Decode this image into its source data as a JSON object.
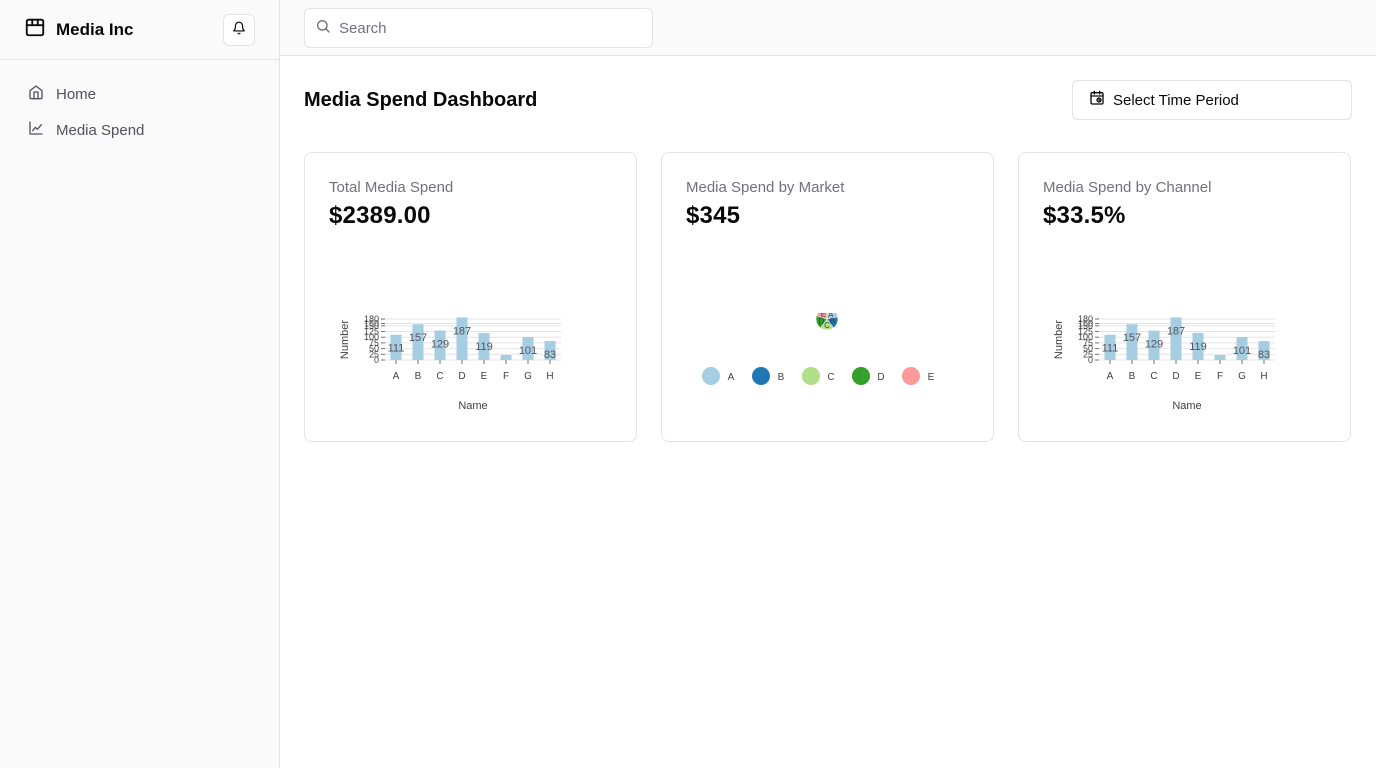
{
  "sidebar": {
    "brand": "Media Inc",
    "nav": [
      {
        "label": "Home",
        "icon": "home-icon"
      },
      {
        "label": "Media Spend",
        "icon": "line-chart-icon"
      }
    ]
  },
  "search": {
    "placeholder": "Search",
    "value": ""
  },
  "header": {
    "title": "Media Spend Dashboard",
    "period_button": "Select Time Period"
  },
  "cards": [
    {
      "label": "Total Media Spend",
      "value": "$2389.00"
    },
    {
      "label": "Media Spend by Market",
      "value": "$345"
    },
    {
      "label": "Media Spend by Channel",
      "value": "$33.5%"
    }
  ],
  "colors": {
    "bar": "#a6cee3",
    "pie": [
      "#a6cee3",
      "#1f78b4",
      "#b2df8a",
      "#33a02c",
      "#fb9a99"
    ]
  },
  "chart_data": [
    {
      "type": "bar",
      "categories": [
        "A",
        "B",
        "C",
        "D",
        "E",
        "F",
        "G",
        "H"
      ],
      "values": [
        111,
        157,
        129,
        187,
        119,
        22,
        101,
        83
      ],
      "data_labels": [
        "111",
        "157",
        "129",
        "187",
        "119",
        "",
        "101",
        "83"
      ],
      "xlabel": "Name",
      "ylabel": "Number",
      "ylim": [
        0,
        180
      ],
      "yticks": [
        "0",
        "25",
        "50",
        "75",
        "100",
        "125",
        "150",
        "160",
        "180"
      ],
      "grid": true
    },
    {
      "type": "pie",
      "categories": [
        "A",
        "B",
        "C",
        "D",
        "E"
      ],
      "values": [
        22,
        18,
        20,
        20,
        20
      ],
      "legend": "bottom"
    },
    {
      "type": "bar",
      "categories": [
        "A",
        "B",
        "C",
        "D",
        "E",
        "F",
        "G",
        "H"
      ],
      "values": [
        111,
        157,
        129,
        187,
        119,
        22,
        101,
        83
      ],
      "data_labels": [
        "111",
        "157",
        "129",
        "187",
        "119",
        "",
        "101",
        "83"
      ],
      "xlabel": "Name",
      "ylabel": "Number",
      "ylim": [
        0,
        180
      ],
      "yticks": [
        "0",
        "25",
        "50",
        "75",
        "100",
        "125",
        "150",
        "160",
        "180"
      ],
      "grid": true
    }
  ]
}
